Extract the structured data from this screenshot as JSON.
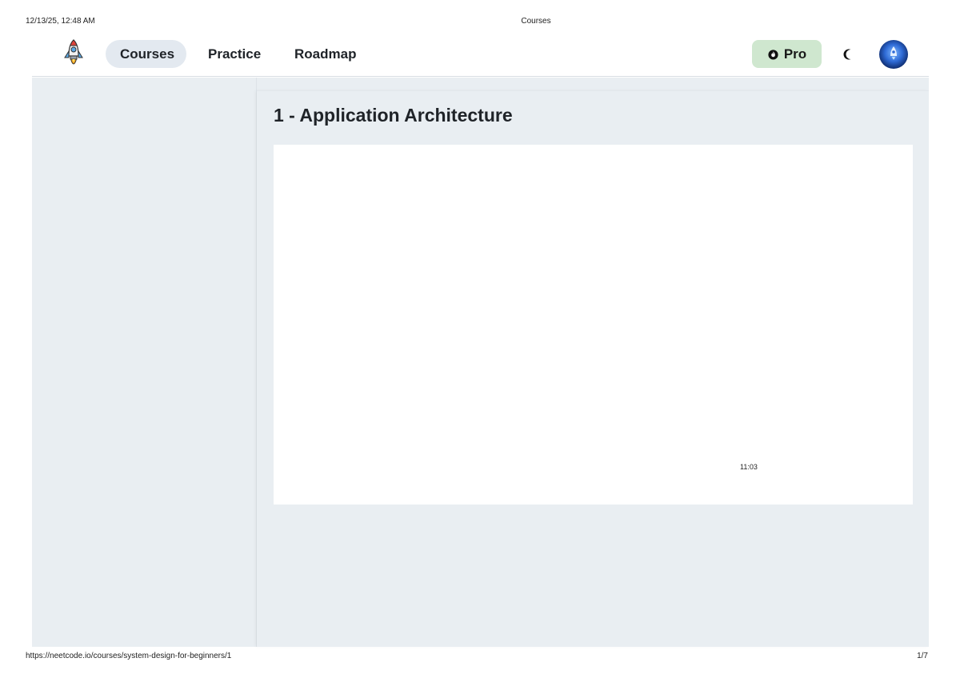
{
  "print": {
    "datetime": "12/13/25, 12:48 AM",
    "page_title": "Courses",
    "url": "https://neetcode.io/courses/system-design-for-beginners/1",
    "page_number": "1/7"
  },
  "nav": {
    "logo_icon": "rocket-icon",
    "links": [
      {
        "label": "Courses",
        "active": true
      },
      {
        "label": "Practice",
        "active": false
      },
      {
        "label": "Roadmap",
        "active": false
      }
    ],
    "pro_label": "Pro",
    "pro_icon": "fire-icon",
    "theme_icon": "moon-icon",
    "avatar_icon": "avatar"
  },
  "lesson": {
    "title": "1 - Application Architecture",
    "video_time": "11:03"
  },
  "colors": {
    "active_nav_bg": "#e3e9f0",
    "pro_bg": "#cfe7cf",
    "page_bg": "#e9eef2"
  }
}
